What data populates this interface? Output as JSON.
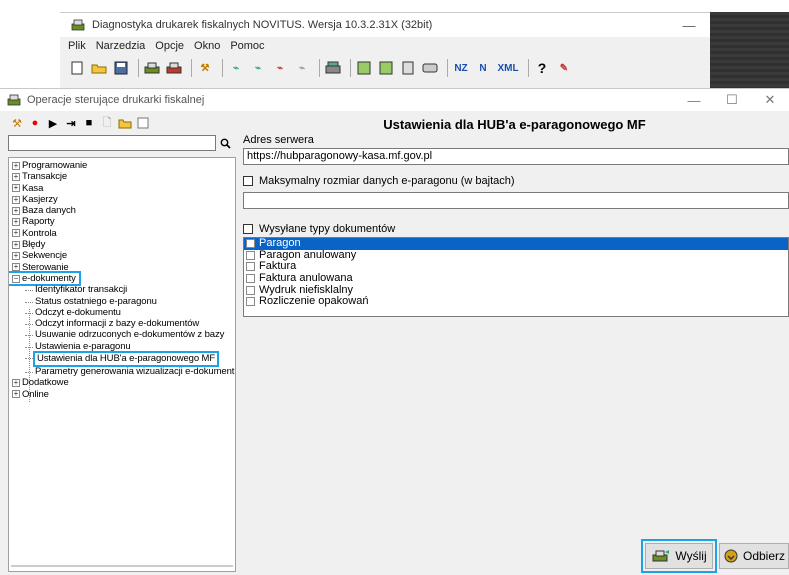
{
  "main_window": {
    "title": "Diagnostyka drukarek fiskalnych NOVITUS. Wersja 10.3.2.31X (32bit)",
    "menu": [
      "Plik",
      "Narzedzia",
      "Opcje",
      "Okno",
      "Pomoc"
    ],
    "toolbar_text_buttons": [
      "NZ",
      "N",
      "XML",
      "?"
    ]
  },
  "dialog": {
    "title": "Operacje sterujące drukarki fiskalnej",
    "controls": {
      "minimize": "—",
      "maximize": "☐",
      "close": "✕"
    }
  },
  "tree": {
    "nodes": [
      {
        "label": "Programowanie",
        "expander": "+"
      },
      {
        "label": "Transakcje",
        "expander": "+"
      },
      {
        "label": "Kasa",
        "expander": "+"
      },
      {
        "label": "Kasjerzy",
        "expander": "+"
      },
      {
        "label": "Baza danych",
        "expander": "+"
      },
      {
        "label": "Raporty",
        "expander": "+"
      },
      {
        "label": "Kontrola",
        "expander": "+"
      },
      {
        "label": "Błędy",
        "expander": "+"
      },
      {
        "label": "Sekwencje",
        "expander": "+"
      },
      {
        "label": "Sterowanie",
        "expander": "+"
      },
      {
        "label": "e-dokumenty",
        "expander": "−"
      }
    ],
    "children": [
      "Identyfikator transakcji",
      "Status ostatniego e-paragonu",
      "Odczyt e-dokumentu",
      "Odczyt informacji z bazy e-dokumentów",
      "Usuwanie odrzuconych e-dokumentów z bazy",
      "Ustawienia e-paragonu",
      "Ustawienia dla HUB'a e-paragonowego MF",
      "Parametry generowania wizualizacji e-dokument"
    ],
    "after": [
      {
        "label": "Dodatkowe",
        "expander": "+"
      },
      {
        "label": "Online",
        "expander": "+"
      }
    ]
  },
  "settings": {
    "title": "Ustawienia dla HUB'a e-paragonowego MF",
    "server_label": "Adres serwera",
    "server_value": "https://hubparagonowy-kasa.mf.gov.pl",
    "max_size_label": "Maksymalny rozmiar danych e-paragonu (w bajtach)",
    "max_size_value": "",
    "doc_types_label": "Wysyłane typy dokumentów",
    "doc_types": [
      "Paragon",
      "Paragon anulowany",
      "Faktura",
      "Faktura anulowana",
      "Wydruk niefisklalny",
      "Rozliczenie opakowań"
    ],
    "selected_doc_type": "Paragon"
  },
  "buttons": {
    "send": "Wyślij",
    "receive": "Odbierz"
  },
  "colors": {
    "highlight": "#1aa3e8",
    "selection": "#0a64c8"
  }
}
